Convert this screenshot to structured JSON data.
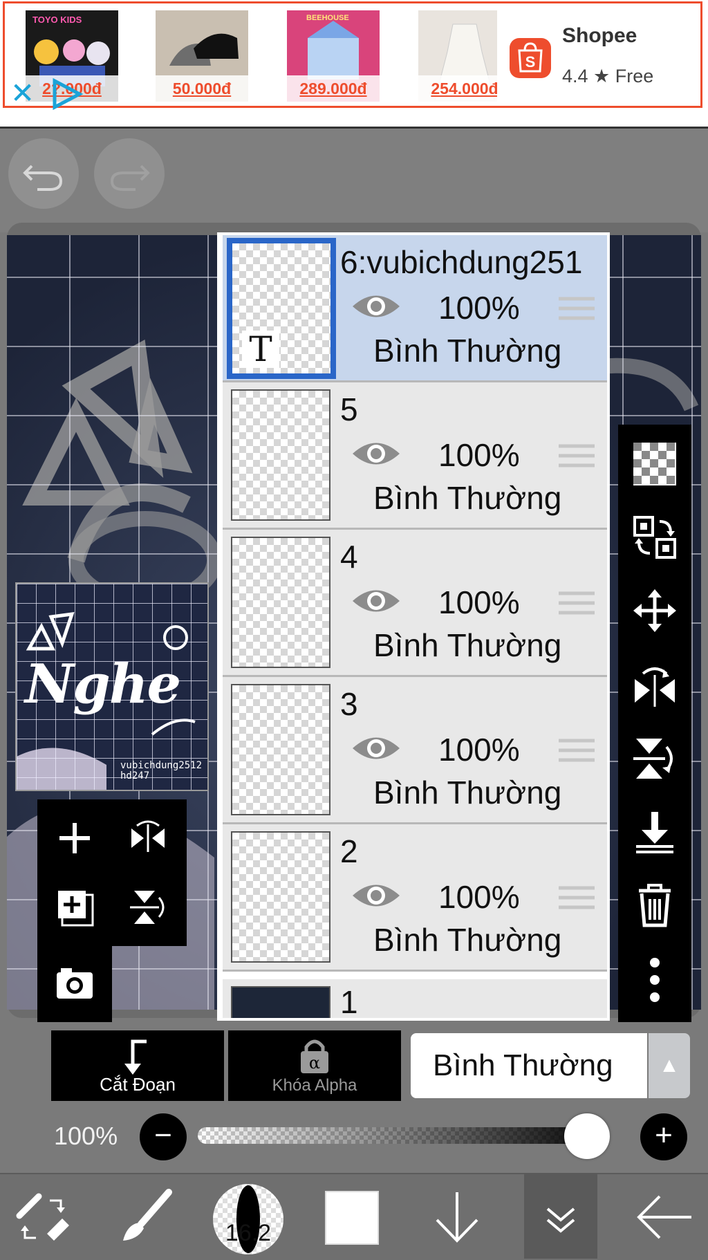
{
  "ad": {
    "prices": [
      "2?.000đ",
      "50.000đ",
      "289.000đ",
      "254.000đ"
    ],
    "product_badges": [
      "TOYO KIDS",
      "",
      "BEEHOUSE",
      ""
    ],
    "store_name": "Shopee",
    "rating_text": "4.4 ★  Free",
    "close_glyph": "✕"
  },
  "canvas": {
    "thumbnail_text": "Nghe",
    "thumbnail_credit": "vubichdung2512\nhd247"
  },
  "layers": [
    {
      "name": "6:vubichdung251",
      "opacity": "100%",
      "blend": "Bình Thường",
      "selected": true,
      "type": "text",
      "type_glyph": "T"
    },
    {
      "name": "5",
      "opacity": "100%",
      "blend": "Bình Thường",
      "selected": false
    },
    {
      "name": "4",
      "opacity": "100%",
      "blend": "Bình Thường",
      "selected": false
    },
    {
      "name": "3",
      "opacity": "100%",
      "blend": "Bình Thường",
      "selected": false
    },
    {
      "name": "2",
      "opacity": "100%",
      "blend": "Bình Thường",
      "selected": false
    },
    {
      "name": "1",
      "partial": true
    }
  ],
  "controls": {
    "clip_label": "Cắt Đoạn",
    "alpha_label": "Khóa Alpha",
    "alpha_glyph": "α",
    "blend_mode": "Bình Thường",
    "blend_arrow": "▲",
    "opacity_label": "100%",
    "opacity_value": 100,
    "minus_glyph": "−",
    "plus_glyph": "+"
  },
  "toolbar": {
    "brush_size": "16.2",
    "color": "#ffffff"
  },
  "colors": {
    "shopee": "#ee4d2d",
    "selected_layer": "#c7d6ec",
    "selection_border": "#2a66c8"
  },
  "icons": {
    "left_tools": [
      "plus-icon",
      "flip-horizontal-icon",
      "add-layer-icon",
      "flip-vertical-icon",
      "camera-icon"
    ],
    "right_tools": [
      "transparency-icon",
      "move-to-layer-icon",
      "move-icon",
      "flip-horizontal-icon",
      "flip-vertical-icon",
      "merge-down-icon",
      "trash-icon",
      "more-icon"
    ],
    "toolbar": [
      "tool-switch-icon",
      "brush-icon",
      "brush-size",
      "color-swatch",
      "arrow-down-icon",
      "double-chevron-down-icon",
      "back-arrow-icon"
    ]
  }
}
